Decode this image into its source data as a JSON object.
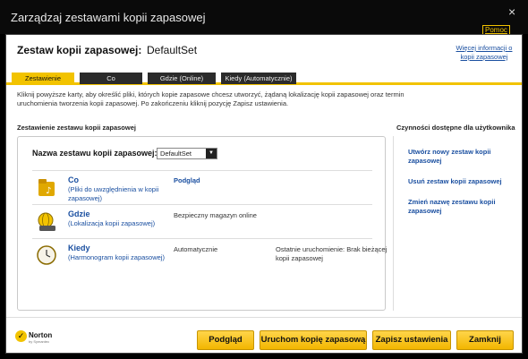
{
  "window": {
    "title": "Zarządzaj zestawami kopii zapasowej",
    "help_link": "Pomoc",
    "close_glyph": "×"
  },
  "header": {
    "label": "Zestaw kopii zapasowej:",
    "value": "DefaultSet",
    "more_info_link": "Więcej informacji o kopii zapasowej"
  },
  "tabs": [
    {
      "label": "Zestawienie",
      "active": true
    },
    {
      "label": "Co",
      "active": false
    },
    {
      "label": "Gdzie (Online)",
      "active": false
    },
    {
      "label": "Kiedy (Automatycznie)",
      "active": false
    }
  ],
  "description": "Kliknij powyższe karty, aby określić pliki, których kopie zapasowe chcesz utworzyć, żądaną lokalizację kopii zapasowej oraz termin uruchomienia tworzenia kopii zapasowej. Po zakończeniu kliknij pozycję Zapisz ustawienia.",
  "summary": {
    "section_title": "Zestawienie zestawu kopii zapasowej",
    "name_label": "Nazwa zestawu kopii zapasowej:",
    "name_select_value": "DefaultSet",
    "rows": [
      {
        "icon": "folder-music-icon",
        "title": "Co",
        "subtitle": "(Pliki do uwzględnienia w kopii zapasowej)",
        "middle": "Podgląd",
        "right": ""
      },
      {
        "icon": "globe-drive-icon",
        "title": "Gdzie",
        "subtitle": "(Lokalizacja kopii zapasowej)",
        "middle": "Bezpieczny magazyn online",
        "right": ""
      },
      {
        "icon": "clock-icon",
        "title": "Kiedy",
        "subtitle": "(Harmonogram kopii zapasowej)",
        "middle": "Automatycznie",
        "right": "Ostatnie uruchomienie: Brak bieżącej kopii zapasowej"
      }
    ]
  },
  "actions": {
    "section_title": "Czynności dostępne dla użytkownika",
    "items": [
      "Utwórz nowy zestaw kopii zapasowej",
      "Usuń zestaw kopii zapasowej",
      "Zmień nazwę zestawu kopii zapasowej"
    ]
  },
  "footer": {
    "brand": "Norton",
    "brand_sub": "by Symantec",
    "buttons": {
      "preview": "Podgląd",
      "run_backup": "Uruchom kopię zapasową",
      "save_settings": "Zapisz ustawienia",
      "close": "Zamknij"
    }
  },
  "colors": {
    "accent": "#f2c300",
    "link": "#1a4fa0",
    "titlebar": "#0a0a0a"
  }
}
